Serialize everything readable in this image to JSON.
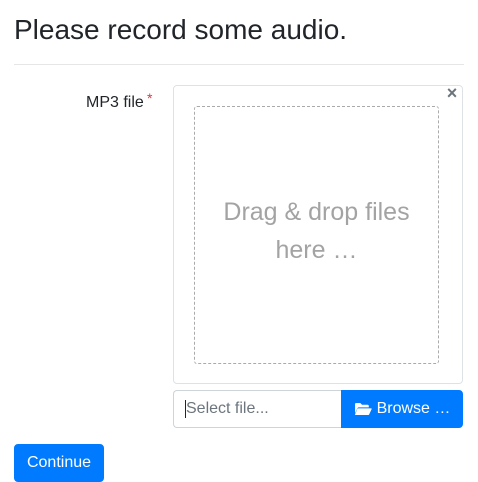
{
  "page": {
    "title": "Please record some audio."
  },
  "form": {
    "field_label": "MP3 file",
    "required_mark": "*",
    "drop_zone_text": "Drag & drop files here …",
    "close_symbol": "×",
    "caption_placeholder": "Select file...",
    "caption_value": "",
    "browse_label": "Browse …",
    "browse_icon": "folder-open-icon",
    "continue_label": "Continue"
  },
  "colors": {
    "primary": "#007bff",
    "required": "#dc3545",
    "drop_text": "#a3a3a3",
    "border": "#dee2e6"
  }
}
